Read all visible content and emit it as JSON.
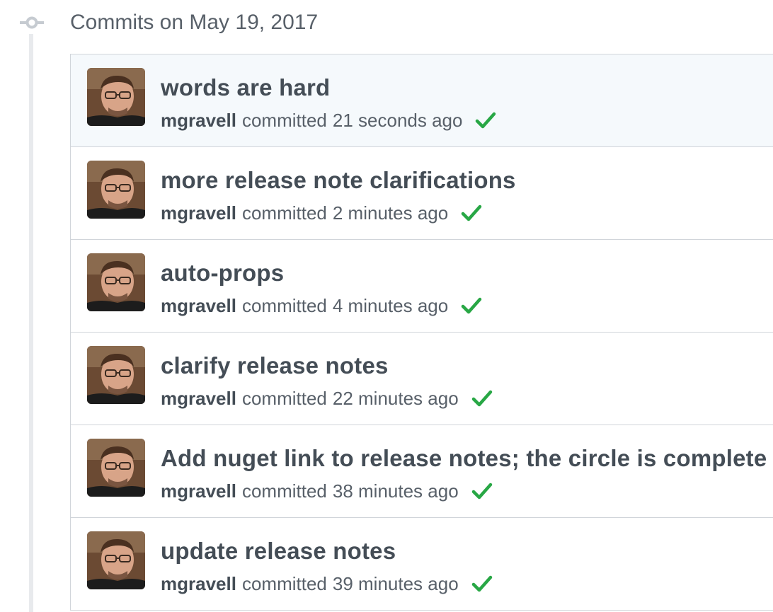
{
  "group": {
    "heading": "Commits on May 19, 2017",
    "icon": "git-commit-icon"
  },
  "colors": {
    "success": "#28a745",
    "text": "#444d56",
    "muted": "#586069",
    "selected_row": "#f5f9fc",
    "border": "#d1d5da"
  },
  "commits": [
    {
      "message": "words are hard",
      "author": "mgravell",
      "verb": "committed",
      "time": "21 seconds ago",
      "status": "check-icon",
      "selected": true
    },
    {
      "message": "more release note clarifications",
      "author": "mgravell",
      "verb": "committed",
      "time": "2 minutes ago",
      "status": "check-icon",
      "selected": false
    },
    {
      "message": "auto-props",
      "author": "mgravell",
      "verb": "committed",
      "time": "4 minutes ago",
      "status": "check-icon",
      "selected": false
    },
    {
      "message": "clarify release notes",
      "author": "mgravell",
      "verb": "committed",
      "time": "22 minutes ago",
      "status": "check-icon",
      "selected": false
    },
    {
      "message": "Add nuget link to release notes; the circle is complete",
      "author": "mgravell",
      "verb": "committed",
      "time": "38 minutes ago",
      "status": "check-icon",
      "selected": false
    },
    {
      "message": "update release notes",
      "author": "mgravell",
      "verb": "committed",
      "time": "39 minutes ago",
      "status": "check-icon",
      "selected": false
    }
  ]
}
